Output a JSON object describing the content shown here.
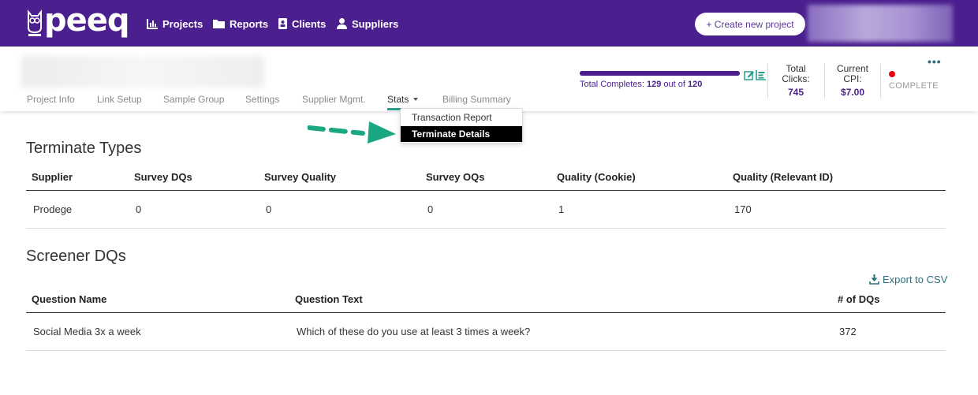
{
  "brand": {
    "name": "peeq"
  },
  "nav": {
    "items": [
      {
        "label": "Projects",
        "icon": "bar-chart-icon"
      },
      {
        "label": "Reports",
        "icon": "folder-icon"
      },
      {
        "label": "Clients",
        "icon": "contact-card-icon"
      },
      {
        "label": "Suppliers",
        "icon": "user-icon"
      }
    ],
    "create_label": "+ Create new project"
  },
  "tabs": [
    {
      "label": "Project Info"
    },
    {
      "label": "Link Setup"
    },
    {
      "label": "Sample Group"
    },
    {
      "label": "Settings"
    },
    {
      "label": "Supplier Mgmt."
    },
    {
      "label": "Stats",
      "active": true
    },
    {
      "label": "Billing Summary"
    }
  ],
  "stats_menu": {
    "items": [
      "Transaction Report",
      "Terminate Details"
    ],
    "selected": "Terminate Details"
  },
  "progress": {
    "label": "Total Completes:",
    "completes": "129",
    "separator": "out of",
    "target": "120",
    "fill_fraction": 1.0
  },
  "stats": {
    "clicks_label_1": "Total",
    "clicks_label_2": "Clicks:",
    "clicks_value": "745",
    "cpi_label_1": "Current",
    "cpi_label_2": "CPI:",
    "cpi_value": "$7.00",
    "status": "COMPLETE",
    "status_color": "#e8000b"
  },
  "terminate_types": {
    "title": "Terminate Types",
    "columns": [
      "Supplier",
      "Survey DQs",
      "Survey Quality",
      "Survey OQs",
      "Quality (Cookie)",
      "Quality (Relevant ID)"
    ],
    "rows": [
      [
        "Prodege",
        "0",
        "0",
        "0",
        "1",
        "170"
      ]
    ]
  },
  "screener_dqs": {
    "title": "Screener DQs",
    "export_label": "Export to CSV",
    "columns": [
      "Question Name",
      "Question Text",
      "# of DQs"
    ],
    "rows": [
      [
        "Social Media 3x a week",
        "Which of these do you use at least 3 times a week?",
        "372"
      ]
    ]
  },
  "colors": {
    "primary": "#4b1f8e",
    "accent": "#2a9d8f",
    "link": "#2a6f7e"
  }
}
